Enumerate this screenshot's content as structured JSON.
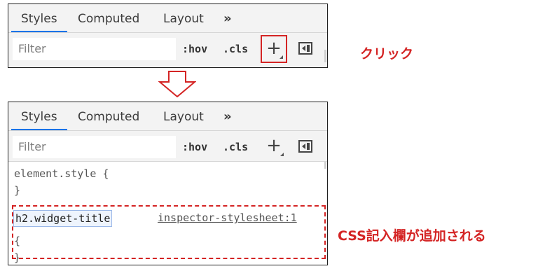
{
  "tabs": [
    "Styles",
    "Computed",
    "Layout"
  ],
  "more_tabs_glyph": "»",
  "filter_placeholder": "Filter",
  "toolbar": {
    "hov": ":hov",
    "cls": ".cls",
    "plus": "+"
  },
  "annotations": {
    "click": "クリック",
    "css_added": "CSS記入欄が追加される"
  },
  "code": {
    "element_style_open": "element.style {",
    "element_style_close": "}",
    "new_rule_selector": "h2.widget-title",
    "new_rule_source": "inspector-stylesheet:1",
    "new_rule_open": "{",
    "new_rule_close": "}"
  },
  "colors": {
    "accent_blue": "#1a73e8",
    "annotation_red": "#d42424"
  },
  "icons": {
    "new_rule": "plus-icon",
    "toggle_sidebar": "sidebar-toggle-icon",
    "flow_arrow": "down-arrow-icon"
  }
}
